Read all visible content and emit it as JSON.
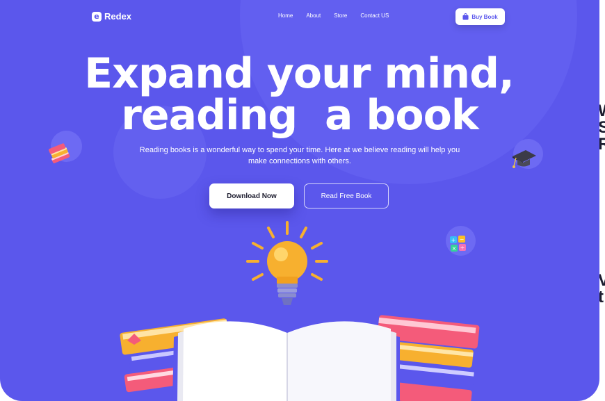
{
  "brand": {
    "name": "Redex",
    "mark": "e"
  },
  "nav": {
    "items": [
      {
        "label": "Home"
      },
      {
        "label": "About"
      },
      {
        "label": "Store"
      },
      {
        "label": "Contact US"
      }
    ],
    "buy_label": "Buy Book"
  },
  "hero": {
    "title_line1": "Expand your mind,",
    "title_line2": "reading  a book",
    "subtitle": "Reading books is a wonderful way to spend your time. Here at we believe reading will help you make connections with others.",
    "primary_cta": "Download Now",
    "secondary_cta": "Read Free Book"
  },
  "colors": {
    "accent": "#5b57ec",
    "text_dark": "#1c1c2e"
  },
  "icons": [
    "bag-icon",
    "book-stack-icon",
    "graduation-cap-icon",
    "calculator-icon",
    "lightbulb-icon",
    "open-book-icon"
  ]
}
